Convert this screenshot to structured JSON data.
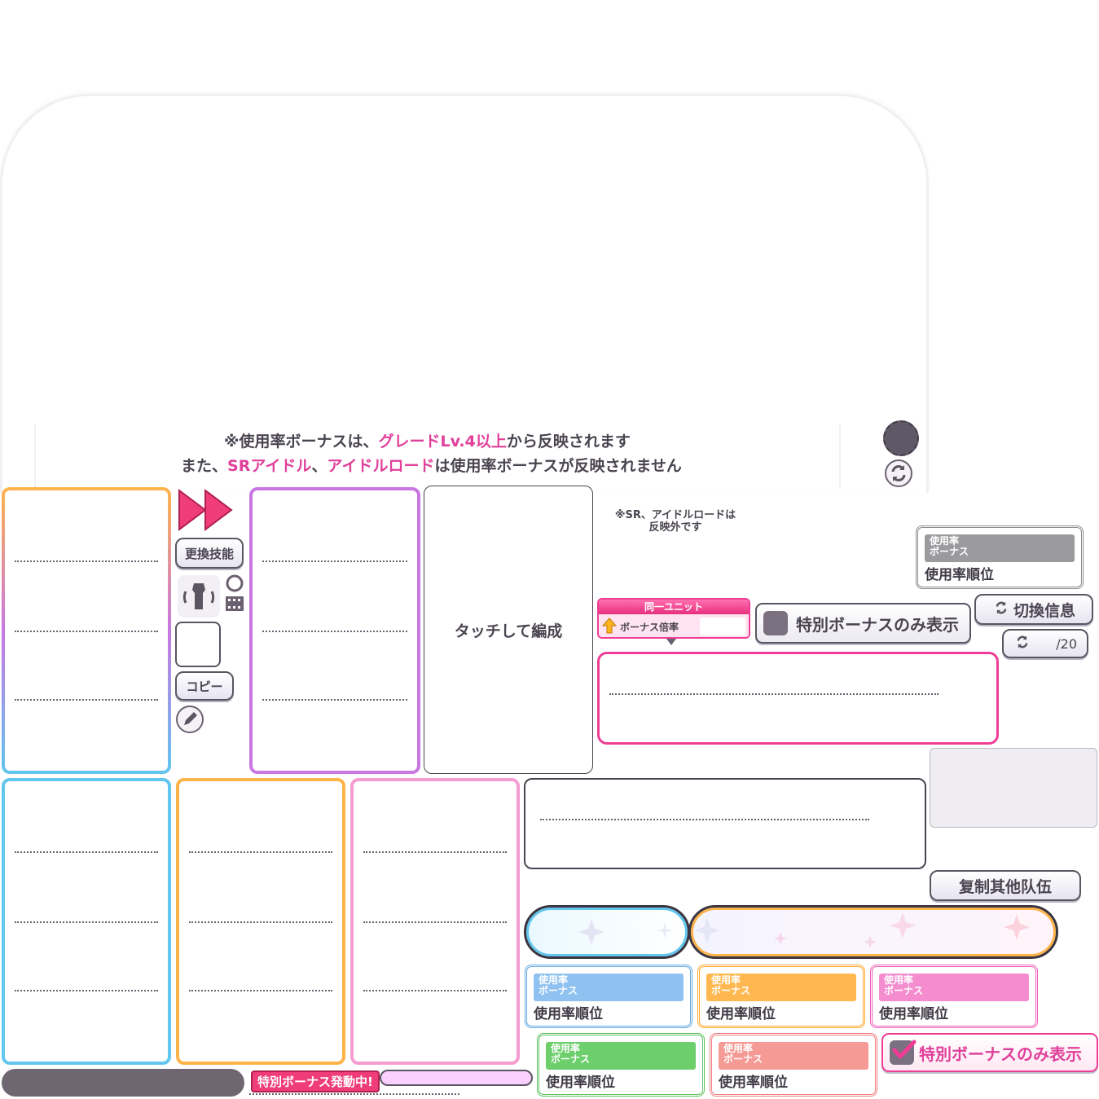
{
  "notice": {
    "line1_prefix": "※使用率ボーナスは、",
    "line1_highlight": "グレードLv.4以上",
    "line1_suffix": "から反映されます",
    "line2_prefix": "また、",
    "line2_highlight1": "SRアイドル",
    "line2_sep": "、",
    "line2_highlight2": "アイドルロード",
    "line2_suffix": "は使用率ボーナスが反映されません"
  },
  "sr_note": {
    "line1": "※SR、アイドルロードは",
    "line2": "反映外です"
  },
  "buttons": {
    "skill_swap": "更換技能",
    "copy": "コピー",
    "touch_to_edit": "タッチして編成",
    "switch_info": "切換信息",
    "copy_other_team": "复制其他队伍"
  },
  "counter": {
    "suffix": "/20"
  },
  "unit": {
    "tab": "同一ユニット",
    "label": "ボーナス倍率"
  },
  "special_only": {
    "unchecked_label": "特別ボーナスのみ表示",
    "checked_label": "特別ボーナスのみ表示"
  },
  "special_active_label": "特別ボーナス発動中!",
  "rank_cards": {
    "bar_line1": "使用率",
    "bar_line2": "ボーナス",
    "foot": "使用率順位"
  },
  "colors": {
    "pink": "#ef3d96",
    "purple": "#c877e3",
    "blue": "#62c6ee",
    "orange": "#ffb44a",
    "lightpink": "#f59cd1",
    "green": "#6dcf6c",
    "salmon": "#f59a95",
    "gray": "#8c8c92"
  },
  "icons": {
    "fast_forward": "fast-forward-icon",
    "outfit": "outfit-rotate-icon",
    "film": "film-icon",
    "pencil": "pencil-icon",
    "refresh": "refresh-icon",
    "arrow_up": "arrow-up-icon",
    "check": "check-icon"
  }
}
